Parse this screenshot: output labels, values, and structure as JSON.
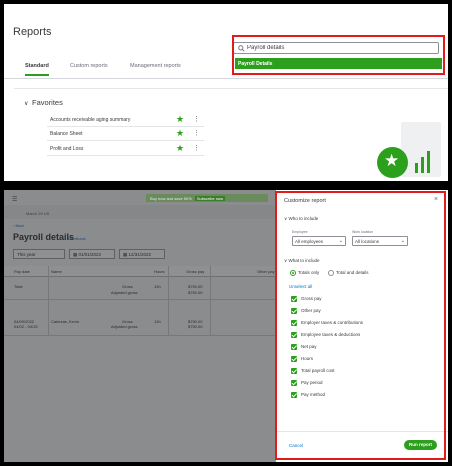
{
  "reports": {
    "title": "Reports",
    "tabs": [
      {
        "label": "Standard",
        "active": true
      },
      {
        "label": "Custom reports",
        "active": false
      },
      {
        "label": "Management reports",
        "active": false
      }
    ],
    "search": {
      "value": "Payroll details",
      "suggestion": "Payroll Details"
    },
    "favorites_title": "Favorites",
    "favorites": [
      {
        "label": "Accounts receivable aging summary"
      },
      {
        "label": "Balance Sheet"
      },
      {
        "label": "Profit and Loss"
      }
    ]
  },
  "payroll": {
    "promo_text": "Buy now and save 50%",
    "promo_cta": "Subscribe now",
    "date_top": "March 29 US",
    "back_label": "‹ Back",
    "title": "Payroll details",
    "feedback": "Feedback",
    "period": "This year",
    "from_date": "01/01/2022",
    "to_date": "12/31/2022",
    "columns": [
      "Pay date",
      "Name",
      "Hours",
      "Gross pay",
      "Other pay"
    ],
    "rows": [
      {
        "pay_date": "Total",
        "name": "",
        "gross_label": "Gross",
        "adj_label": "Adjusted gross",
        "hours": "13h",
        "gross": "$750.00",
        "adj_gross": "$750.00"
      },
      {
        "pay_date": "04/09/2022",
        "pay_period": "04/02 - 04/15",
        "name": "Cabezas, Kevin",
        "gross_label": "Gross",
        "adj_label": "Adjusted gross",
        "hours": "13h",
        "gross": "$750.00",
        "adj_gross": "$750.00"
      }
    ]
  },
  "modal": {
    "title": "Customize report",
    "close": "×",
    "who_title": "Who to include",
    "employee_label": "Employee",
    "employee_value": "All employees",
    "location_label": "Work location",
    "location_value": "All locations",
    "what_title": "What to include",
    "radio_totals": "Totals only",
    "radio_details": "Total and details",
    "unselect_all": "Unselect all",
    "checkboxes": [
      "Gross pay",
      "Other pay",
      "Employer taxes & contributions",
      "Employee taxes & deductions",
      "Net pay",
      "Hours",
      "Total payroll cost",
      "Pay period",
      "Pay method"
    ],
    "cancel": "Cancel",
    "run": "Run report"
  }
}
